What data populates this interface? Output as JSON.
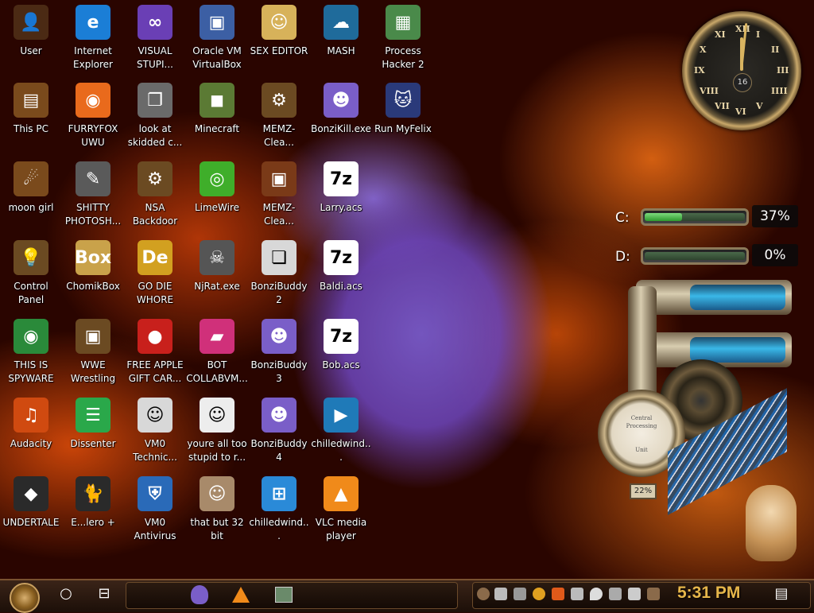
{
  "desktop": {
    "icons": [
      {
        "label": "User",
        "color": "#4b2a14",
        "glyph": "👤"
      },
      {
        "label": "Internet Explorer",
        "color": "#1b7ed6",
        "glyph": "e"
      },
      {
        "label": "VISUAL STUPI...",
        "color": "#6a3fb5",
        "glyph": "∞"
      },
      {
        "label": "Oracle VM VirtualBox",
        "color": "#3c5fa4",
        "glyph": "▣"
      },
      {
        "label": "SEX EDITOR",
        "color": "#d7b25a",
        "glyph": "☺"
      },
      {
        "label": "MASH",
        "color": "#1f6b9b",
        "glyph": "☁"
      },
      {
        "label": "Process Hacker 2",
        "color": "#4a8a4a",
        "glyph": "▦"
      },
      {
        "label": "This PC",
        "color": "#7a4a1c",
        "glyph": "▤"
      },
      {
        "label": "FURRYFOX UWU",
        "color": "#e96a1c",
        "glyph": "◉"
      },
      {
        "label": "look at skidded c...",
        "color": "#6a6a6a",
        "glyph": "❐"
      },
      {
        "label": "Minecraft",
        "color": "#5b7a34",
        "glyph": "◼"
      },
      {
        "label": "MEMZ-Clea...",
        "color": "#6b4a22",
        "glyph": "⚙"
      },
      {
        "label": "BonziKill.exe",
        "color": "#7a5ec8",
        "glyph": "☻"
      },
      {
        "label": "Run MyFelix",
        "color": "#2a3a7a",
        "glyph": "🐱"
      },
      {
        "label": "moon girl",
        "color": "#7a4a1c",
        "glyph": "☄"
      },
      {
        "label": "SHITTY PHOTOSH...",
        "color": "#5a5a5a",
        "glyph": "✎"
      },
      {
        "label": "NSA Backdoor",
        "color": "#6b4a22",
        "glyph": "⚙"
      },
      {
        "label": "LimeWire",
        "color": "#3fae2a",
        "glyph": "◎"
      },
      {
        "label": "MEMZ-Clea...",
        "color": "#7a3a18",
        "glyph": "▣"
      },
      {
        "label": "Larry.acs",
        "color": "#ffffff",
        "glyph": "7z"
      },
      {
        "label": "Control Panel",
        "color": "#6b4a22",
        "glyph": "💡"
      },
      {
        "label": "ChomikBox",
        "color": "#c9a24a",
        "glyph": "Box"
      },
      {
        "label": "GO DIE WHORE",
        "color": "#d2a020",
        "glyph": "De"
      },
      {
        "label": "NjRat.exe",
        "color": "#555555",
        "glyph": "☠"
      },
      {
        "label": "BonziBuddy2",
        "color": "#d8d8d8",
        "glyph": "❏"
      },
      {
        "label": "Baldi.acs",
        "color": "#ffffff",
        "glyph": "7z"
      },
      {
        "label": "THIS IS SPYWARE",
        "color": "#2a8a3a",
        "glyph": "◉"
      },
      {
        "label": "WWE Wrestling",
        "color": "#6b4a22",
        "glyph": "▣"
      },
      {
        "label": "FREE APPLE GIFT CAR...",
        "color": "#c8201c",
        "glyph": "●"
      },
      {
        "label": "BOT COLLABVM...",
        "color": "#d0307a",
        "glyph": "▰"
      },
      {
        "label": "BonziBuddy3",
        "color": "#7a5ec8",
        "glyph": "☻"
      },
      {
        "label": "Bob.acs",
        "color": "#ffffff",
        "glyph": "7z"
      },
      {
        "label": "Audacity",
        "color": "#d04a10",
        "glyph": "♫"
      },
      {
        "label": "Dissenter",
        "color": "#2aa84a",
        "glyph": "☰"
      },
      {
        "label": "VM0 Technic...",
        "color": "#d8d8d8",
        "glyph": "☺"
      },
      {
        "label": "youre all too stupid to r...",
        "color": "#ededed",
        "glyph": "☺"
      },
      {
        "label": "BonziBuddy4",
        "color": "#7a5ec8",
        "glyph": "☻"
      },
      {
        "label": "chilledwind...",
        "color": "#1f7ab8",
        "glyph": "▶"
      },
      {
        "label": "UNDERTALE",
        "color": "#2a2a2a",
        "glyph": "◆"
      },
      {
        "label": "E...lero +",
        "color": "#2a2a2a",
        "glyph": "🐈"
      },
      {
        "label": "VM0 Antivirus",
        "color": "#2a6ab8",
        "glyph": "⛨"
      },
      {
        "label": "that but 32 bit",
        "color": "#a88a6a",
        "glyph": "☺"
      },
      {
        "label": "chilledwind...",
        "color": "#2a8ad8",
        "glyph": "⊞"
      },
      {
        "label": "VLC media player",
        "color": "#f08a1a",
        "glyph": "▲"
      }
    ]
  },
  "clock_widget": {
    "numerals": [
      "XII",
      "I",
      "II",
      "III",
      "IIII",
      "V",
      "VI",
      "VII",
      "VIII",
      "IX",
      "X",
      "XI"
    ],
    "date": "16"
  },
  "drives": [
    {
      "letter": "C:",
      "percent_text": "37%",
      "fill": 0.37
    },
    {
      "letter": "D:",
      "percent_text": "0%",
      "fill": 0.0
    }
  ],
  "gauge": {
    "label_top": "Central",
    "label_mid": "Processing",
    "label_bot": "Unit",
    "readout": "22%"
  },
  "taskbar": {
    "search_icon": "○",
    "taskview_icon": "⊟",
    "pinned": [
      "bonzi-icon",
      "vlc-icon",
      "network-app-icon"
    ],
    "clock": "5:31 PM",
    "notification_icon": "▤"
  }
}
